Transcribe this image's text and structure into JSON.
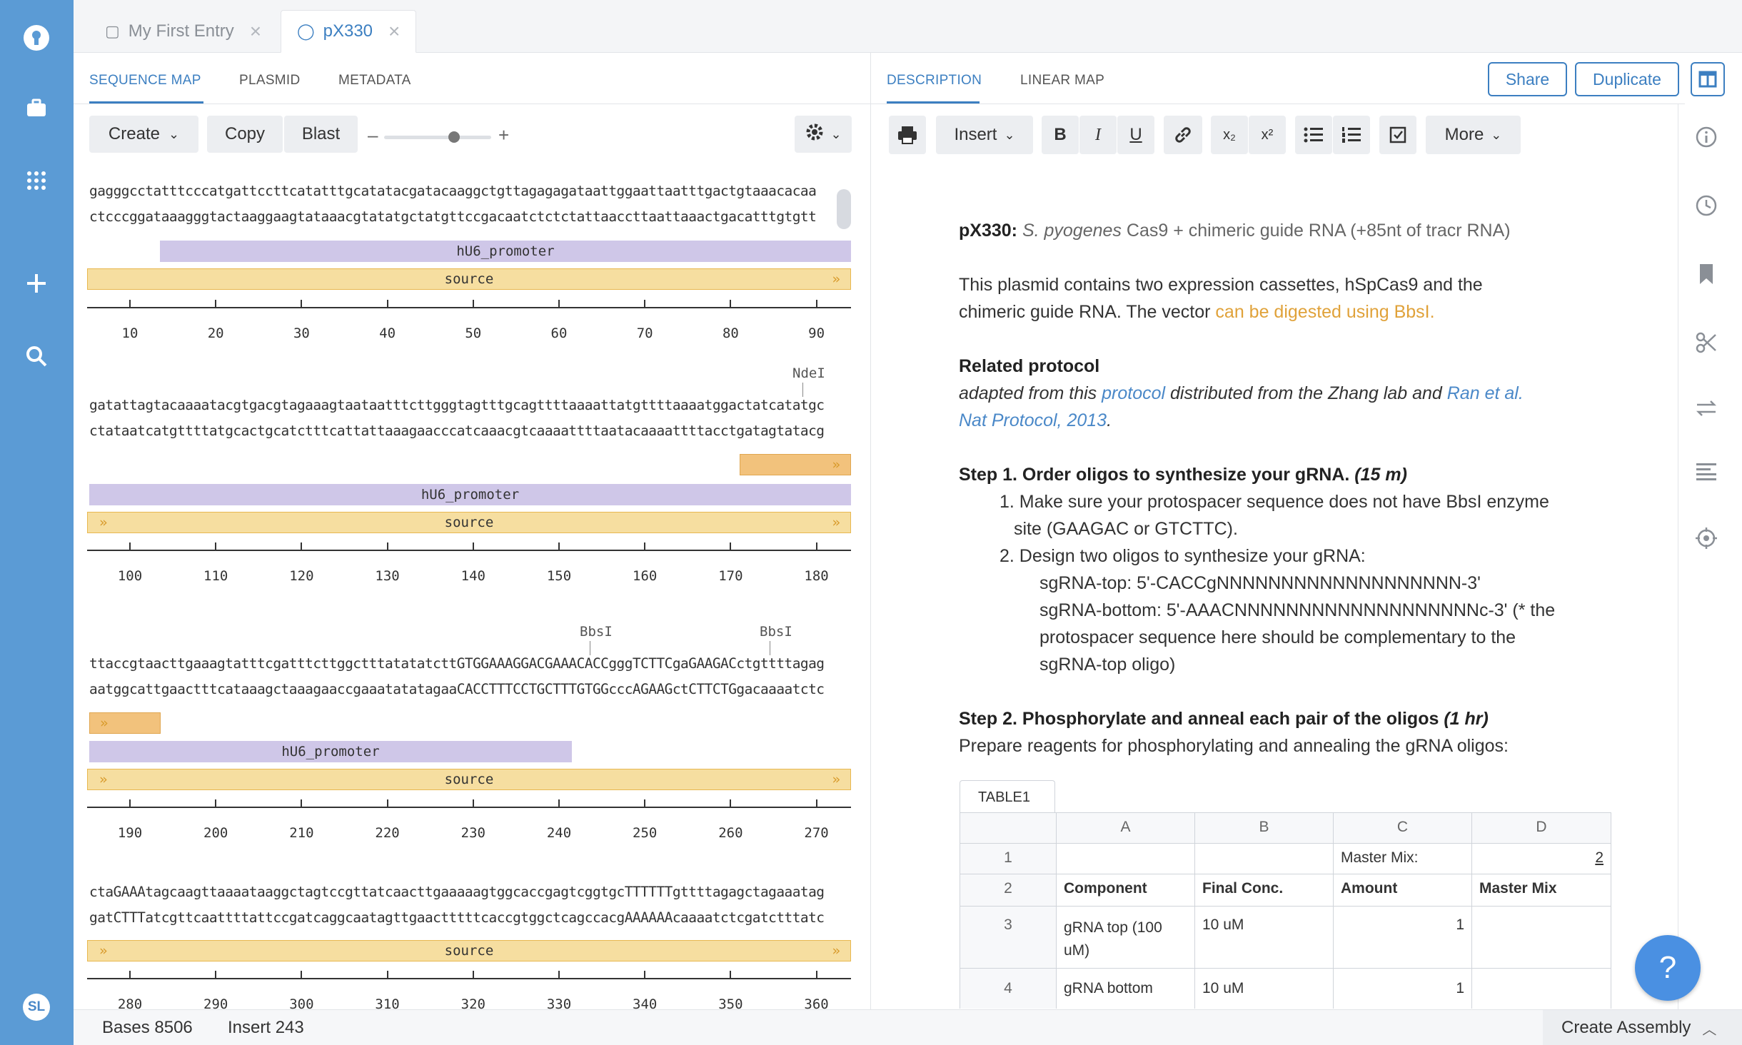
{
  "nav": {
    "user_initials": "SL"
  },
  "tabs": [
    {
      "label": "My First Entry"
    },
    {
      "label": "pX330"
    }
  ],
  "left_tabs": [
    "SEQUENCE MAP",
    "PLASMID",
    "METADATA"
  ],
  "right_tabs": [
    "DESCRIPTION",
    "LINEAR MAP"
  ],
  "seq_toolbar": {
    "create": "Create",
    "copy": "Copy",
    "blast": "Blast",
    "zoom_minus": "–",
    "zoom_plus": "+",
    "zoom_level": 0.65
  },
  "header_buttons": {
    "share": "Share",
    "duplicate": "Duplicate"
  },
  "rows": [
    {
      "top": "gagggcctatttcccatgattccttcatatttgcatatacgatacaaggctgttagagagataattggaattaatttgactgtaaacacaa",
      "bottom": "ctcccggataaagggtactaaggaagtataaacgtatatgctatgttccgacaatctctctattaaccttaattaaactgacatttgtgtt",
      "hu6": "hU6_promoter",
      "source": "source",
      "ticks": [
        "10",
        "20",
        "30",
        "40",
        "50",
        "60",
        "70",
        "80",
        "90"
      ]
    },
    {
      "enzyme": "NdeI",
      "top": "gatattagtacaaaatacgtgacgtagaaagtaataatttcttgggtagtttgcagttttaaaattatgttttaaaatggactatcatatgc",
      "bottom": "ctataatcatgttttatgcactgcatctttcattattaaagaacccatcaaacgtcaaaattttaatacaaaattttacctgatagtatacg",
      "hu6": "hU6_promoter",
      "source": "source",
      "ticks": [
        "100",
        "110",
        "120",
        "130",
        "140",
        "150",
        "160",
        "170",
        "180"
      ]
    },
    {
      "enzyme1": "BbsI",
      "enzyme2": "BbsI",
      "top": "ttaccgtaacttgaaagtatttcgatttcttggctttatatatcttGTGGAAAGGACGAAACACCgggTCTTCgaGAAGACctgttttagag",
      "bottom": "aatggcattgaactttcataaagctaaagaaccgaaatatatagaaCACCTTTCCTGCTTTGTGGcccAGAAGctCTTCTGgacaaaatctc",
      "hu6": "hU6_promoter",
      "source": "source",
      "ticks": [
        "190",
        "200",
        "210",
        "220",
        "230",
        "240",
        "250",
        "260",
        "270"
      ]
    },
    {
      "top": "ctaGAAAtagcaagttaaaataaggctagtccgttatcaacttgaaaaagtggcaccgagtcggtgcTTTTTTgttttagagctagaaatag",
      "bottom": "gatCTTTatcgttcaattttattccgatcaggcaatagttgaactttttcaccgtggctcagccacgAAAAAAcaaaatctcgatctttatc",
      "source": "source",
      "ticks": [
        "280",
        "290",
        "300",
        "310",
        "320",
        "330",
        "340",
        "350",
        "360"
      ]
    }
  ],
  "editor_toolbar": {
    "insert": "Insert",
    "bold": "B",
    "italic": "I",
    "underline": "U",
    "subscript": "x₂",
    "superscript": "x²",
    "more": "More"
  },
  "description": {
    "title_bold": "pX330:",
    "title_species": "S. pyogenes",
    "title_rest": "Cas9 + chimeric guide RNA (+85nt of tracr RNA)",
    "p1_a": "This plasmid contains two expression cassettes, hSpCas9 and the",
    "p1_b": "chimeric guide RNA. The vector",
    "p1_link": "can be digested using BbsI.",
    "related": "Related protocol",
    "adapted_a": "adapted from this",
    "adapted_link": "protocol",
    "adapted_b": "distributed from the Zhang lab and",
    "adapted_link2": "Ran et al.",
    "adapted_link3": "Nat Protocol, 2013",
    "adapted_end": ".",
    "step1": "Step 1. Order oligos to synthesize your gRNA.",
    "step1_time": "(15 m)",
    "s1_1a": "1. Make sure your protospacer sequence does not have BbsI enzyme",
    "s1_1b": "site (GAAGAC or GTCTTC).",
    "s1_2": "2. Design two oligos to synthesize your gRNA:",
    "s1_top": "sgRNA-top: 5'-CACCgNNNNNNNNNNNNNNNNNNN-3'",
    "s1_bot": "sgRNA-bottom: 5'-AAACNNNNNNNNNNNNNNNNNNNc-3' (* the",
    "s1_bot2": "protospacer sequence here should be complementary to the",
    "s1_bot3": "sgRNA-top oligo)",
    "step2": "Step 2. Phosphorylate and anneal each pair of the oligos",
    "step2_time": "(1 hr)",
    "s2_text": "Prepare reagents for phosphorylating and annealing the gRNA oligos:"
  },
  "table": {
    "tab": "TABLE1",
    "cols": [
      "A",
      "B",
      "C",
      "D"
    ],
    "rows": [
      {
        "n": "1",
        "a": "",
        "b": "",
        "c": "Master Mix:",
        "d": "2"
      },
      {
        "n": "2",
        "a": "Component",
        "b": "Final Conc.",
        "c": "Amount",
        "d": "Master Mix"
      },
      {
        "n": "3",
        "a": "gRNA top (100 uM)",
        "b": "10 uM",
        "c": "1",
        "d": ""
      },
      {
        "n": "4",
        "a": "gRNA bottom",
        "b": "10 uM",
        "c": "1",
        "d": ""
      }
    ]
  },
  "footer": {
    "bases_label": "Bases",
    "bases": "8506",
    "insert_label": "Insert",
    "insert": "243",
    "create_assembly": "Create Assembly"
  },
  "help": "?"
}
